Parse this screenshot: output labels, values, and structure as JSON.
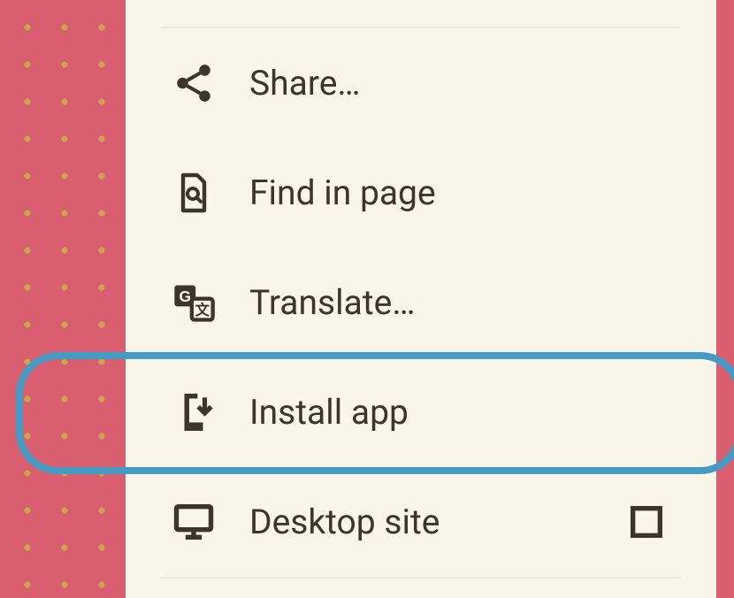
{
  "menu": {
    "items": [
      {
        "label": "Share…",
        "icon": "share-icon"
      },
      {
        "label": "Find in page",
        "icon": "find-in-page-icon"
      },
      {
        "label": "Translate…",
        "icon": "translate-icon"
      },
      {
        "label": "Install app",
        "icon": "install-app-icon",
        "highlighted": true
      },
      {
        "label": "Desktop site",
        "icon": "desktop-icon",
        "checkbox": true,
        "checked": false
      }
    ]
  },
  "colors": {
    "background_panel": "#faf5e9",
    "background_pattern": "#d95e6f",
    "dot": "#c9a84a",
    "icon": "#3d342a",
    "text": "#3d342a",
    "highlight": "#459bc3"
  }
}
